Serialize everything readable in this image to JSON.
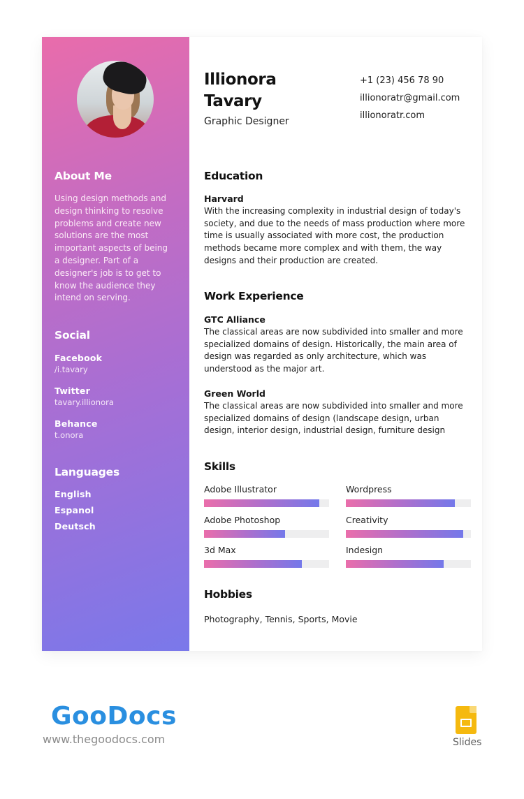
{
  "sidebar": {
    "photo_alt": "Profile photo of woman wearing black hat",
    "about": {
      "heading": "About Me",
      "lines": [
        "Using design methods and",
        "design thinking to resolve",
        "problems and create new",
        "solutions are the most",
        "important aspects of being",
        "a designer. Part of a",
        "designer's job is to get to",
        "know the audience they",
        "intend on serving."
      ]
    },
    "social": {
      "heading": "Social",
      "items": [
        {
          "network": "Facebook",
          "handle": "/i.tavary"
        },
        {
          "network": "Twitter",
          "handle": "tavary.illionora"
        },
        {
          "network": "Behance",
          "handle": "t.onora"
        }
      ]
    },
    "languages": {
      "heading": "Languages",
      "items": [
        "English",
        "Espanol",
        "Deutsch"
      ]
    }
  },
  "header": {
    "first_name": "Illionora",
    "last_name": "Tavary",
    "role": "Graphic Designer",
    "phone": "+1 (23) 456 78 90",
    "email": "illionoratr@gmail.com",
    "website": "illionoratr.com"
  },
  "education": {
    "heading": "Education",
    "entries": [
      {
        "title": "Harvard",
        "lines": [
          "With the increasing complexity in industrial design of today's",
          "society, and due to the needs of mass production where more",
          "time is usually associated with more cost, the production",
          "methods became more complex and with them, the way",
          "designs and their production are created."
        ]
      }
    ]
  },
  "work": {
    "heading": "Work Experience",
    "entries": [
      {
        "title": "GTC Alliance",
        "lines": [
          "The classical areas are now subdivided into smaller and more",
          "specialized domains of design. Historically, the main area of",
          "design was regarded as only architecture, which was",
          "understood as the major art."
        ]
      },
      {
        "title": "Green World",
        "lines": [
          "The classical areas are now subdivided into smaller and more",
          "specialized domains of design (landscape design, urban",
          "design, interior design, industrial design, furniture design"
        ]
      }
    ]
  },
  "skills": {
    "heading": "Skills",
    "items": [
      {
        "name": "Adobe Illustrator",
        "level": 0.92
      },
      {
        "name": "Wordpress",
        "level": 0.87
      },
      {
        "name": "Adobe Photoshop",
        "level": 0.65
      },
      {
        "name": "Creativity",
        "level": 0.94
      },
      {
        "name": "3d Max",
        "level": 0.78
      },
      {
        "name": "Indesign",
        "level": 0.78
      }
    ]
  },
  "hobbies": {
    "heading": "Hobbies",
    "text": "Photography, Tennis, Sports, Movie"
  },
  "footer": {
    "brand": "GooDocs",
    "url": "www.thegoodocs.com",
    "app_label": "Slides"
  },
  "colors": {
    "gradient_start": "#e96cab",
    "gradient_end": "#7a78ea",
    "logo_blue": "#2a8fe0",
    "slides_yellow": "#f5b90f"
  }
}
